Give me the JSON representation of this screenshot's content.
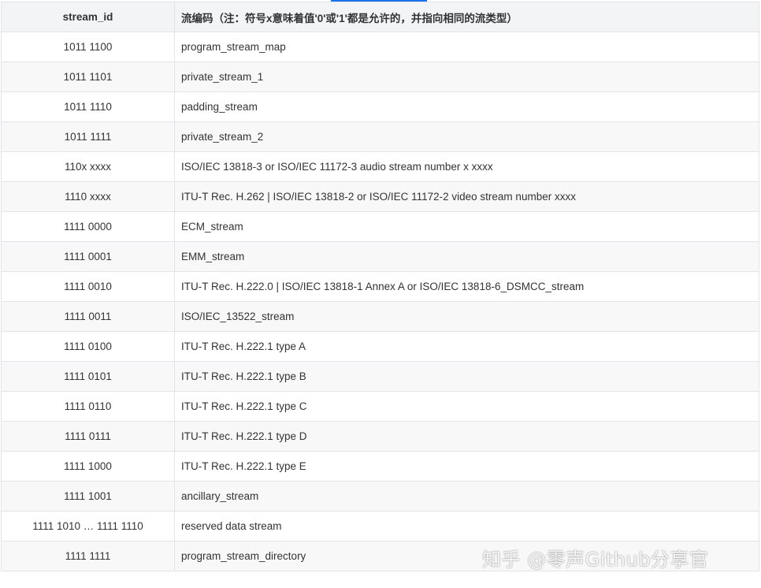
{
  "table": {
    "headers": {
      "stream_id": "stream_id",
      "stream_type": "流编码（注：符号x意味着值'0'或'1'都是允许的，并指向相同的流类型）"
    },
    "rows": [
      {
        "id": "1011 1100",
        "desc": "program_stream_map"
      },
      {
        "id": "1011 1101",
        "desc": "private_stream_1"
      },
      {
        "id": "1011 1110",
        "desc": "padding_stream"
      },
      {
        "id": "1011 1111",
        "desc": "private_stream_2"
      },
      {
        "id": "110x xxxx",
        "desc": "ISO/IEC 13818-3 or ISO/IEC 11172-3 audio stream number x xxxx"
      },
      {
        "id": "1110 xxxx",
        "desc": "ITU-T Rec. H.262 | ISO/IEC 13818-2 or ISO/IEC 11172-2 video stream number xxxx"
      },
      {
        "id": "1111 0000",
        "desc": "ECM_stream"
      },
      {
        "id": "1111 0001",
        "desc": "EMM_stream"
      },
      {
        "id": "1111 0010",
        "desc": "ITU-T Rec. H.222.0 | ISO/IEC 13818-1 Annex A or ISO/IEC 13818-6_DSMCC_stream"
      },
      {
        "id": "1111 0011",
        "desc": "ISO/IEC_13522_stream"
      },
      {
        "id": "1111 0100",
        "desc": "ITU-T Rec. H.222.1 type A"
      },
      {
        "id": "1111 0101",
        "desc": "ITU-T Rec. H.222.1 type B"
      },
      {
        "id": "1111 0110",
        "desc": "ITU-T Rec. H.222.1 type C"
      },
      {
        "id": "1111 0111",
        "desc": "ITU-T Rec. H.222.1 type D"
      },
      {
        "id": "1111 1000",
        "desc": "ITU-T Rec. H.222.1 type E"
      },
      {
        "id": "1111 1001",
        "desc": "ancillary_stream"
      },
      {
        "id": "1111 1010 … 1111 1110",
        "desc": "reserved data stream"
      },
      {
        "id": "1111 1111",
        "desc": "program_stream_directory"
      }
    ]
  },
  "watermark": {
    "text": "知乎 @零声Github分享官"
  },
  "colors": {
    "header_bg": "#f3f4f6",
    "row_alt_bg": "#f8f8f8",
    "border": "#e1e4e8",
    "text": "#333333",
    "accent": "#1a73e8"
  }
}
